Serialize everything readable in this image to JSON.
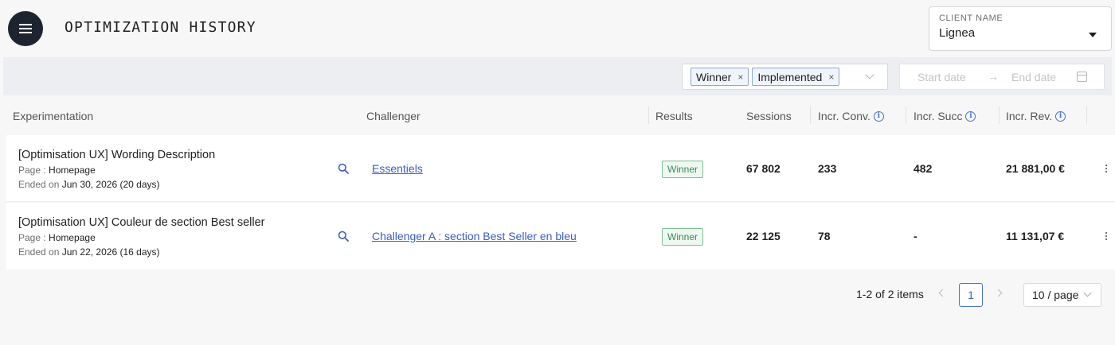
{
  "header": {
    "title": "OPTIMIZATION HISTORY",
    "menu_icon": "hamburger-menu-icon"
  },
  "client": {
    "label": "CLIENT NAME",
    "value": "Lignea"
  },
  "filters": {
    "tags": [
      "Winner",
      "Implemented"
    ],
    "tag_close": "×",
    "start_placeholder": "Start date",
    "end_placeholder": "End date",
    "arrow": "→"
  },
  "table": {
    "columns": {
      "experimentation": "Experimentation",
      "challenger": "Challenger",
      "results": "Results",
      "sessions": "Sessions",
      "incr_conv": "Incr. Conv.",
      "incr_succ": "Incr. Succ",
      "incr_rev": "Incr. Rev."
    },
    "page_label": "Page :",
    "ended_label": "Ended on",
    "rows": [
      {
        "title": "[Optimisation UX] Wording Description",
        "page": "Homepage",
        "ended": "Jun 30, 2026 (20 days)",
        "challenger": "Essentiels",
        "result": "Winner",
        "sessions": "67 802",
        "incr_conv": "233",
        "incr_succ": "482",
        "incr_rev": "21 881,00 €"
      },
      {
        "title": "[Optimisation UX] Couleur de section Best seller",
        "page": "Homepage",
        "ended": "Jun 22, 2026 (16 days)",
        "challenger": "Challenger A : section Best Seller en bleu",
        "result": "Winner",
        "sessions": "22 125",
        "incr_conv": "78",
        "incr_succ": "-",
        "incr_rev": "11 131,07 €"
      }
    ]
  },
  "pagination": {
    "total": "1-2 of 2 items",
    "current": "1",
    "page_size": "10 / page"
  },
  "colors": {
    "accent": "#3a5cc5",
    "winner_green": "#3b8a56",
    "menu_bg": "#1e2330"
  }
}
